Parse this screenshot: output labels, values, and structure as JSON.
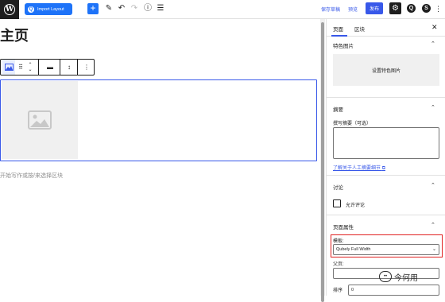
{
  "toolbar": {
    "import_layout": "Import Layout",
    "save_draft": "保存草稿",
    "preview": "预览",
    "publish": "发布"
  },
  "editor": {
    "page_title": "主页",
    "empty_hint": "开始写作或按/来选择区块"
  },
  "sidebar": {
    "tabs": [
      "页面",
      "区块"
    ],
    "featured_image": {
      "heading": "特色图片",
      "button": "设置特色图片"
    },
    "excerpt": {
      "heading": "摘要",
      "label": "撰写摘要（可选）",
      "link": "了解关于人工摘要细节"
    },
    "discussion": {
      "heading": "讨论",
      "allow_comments": "允许评论"
    },
    "page_attributes": {
      "heading": "页面属性",
      "template_label": "模板:",
      "template_value": "Qubely Full Width",
      "parent_label": "父页:",
      "order_label": "排序",
      "order_value": "0"
    }
  },
  "watermark": "今何用",
  "colors": {
    "accent": "#3858e9",
    "qubely": "#1e73f8",
    "highlight": "#e02020"
  }
}
